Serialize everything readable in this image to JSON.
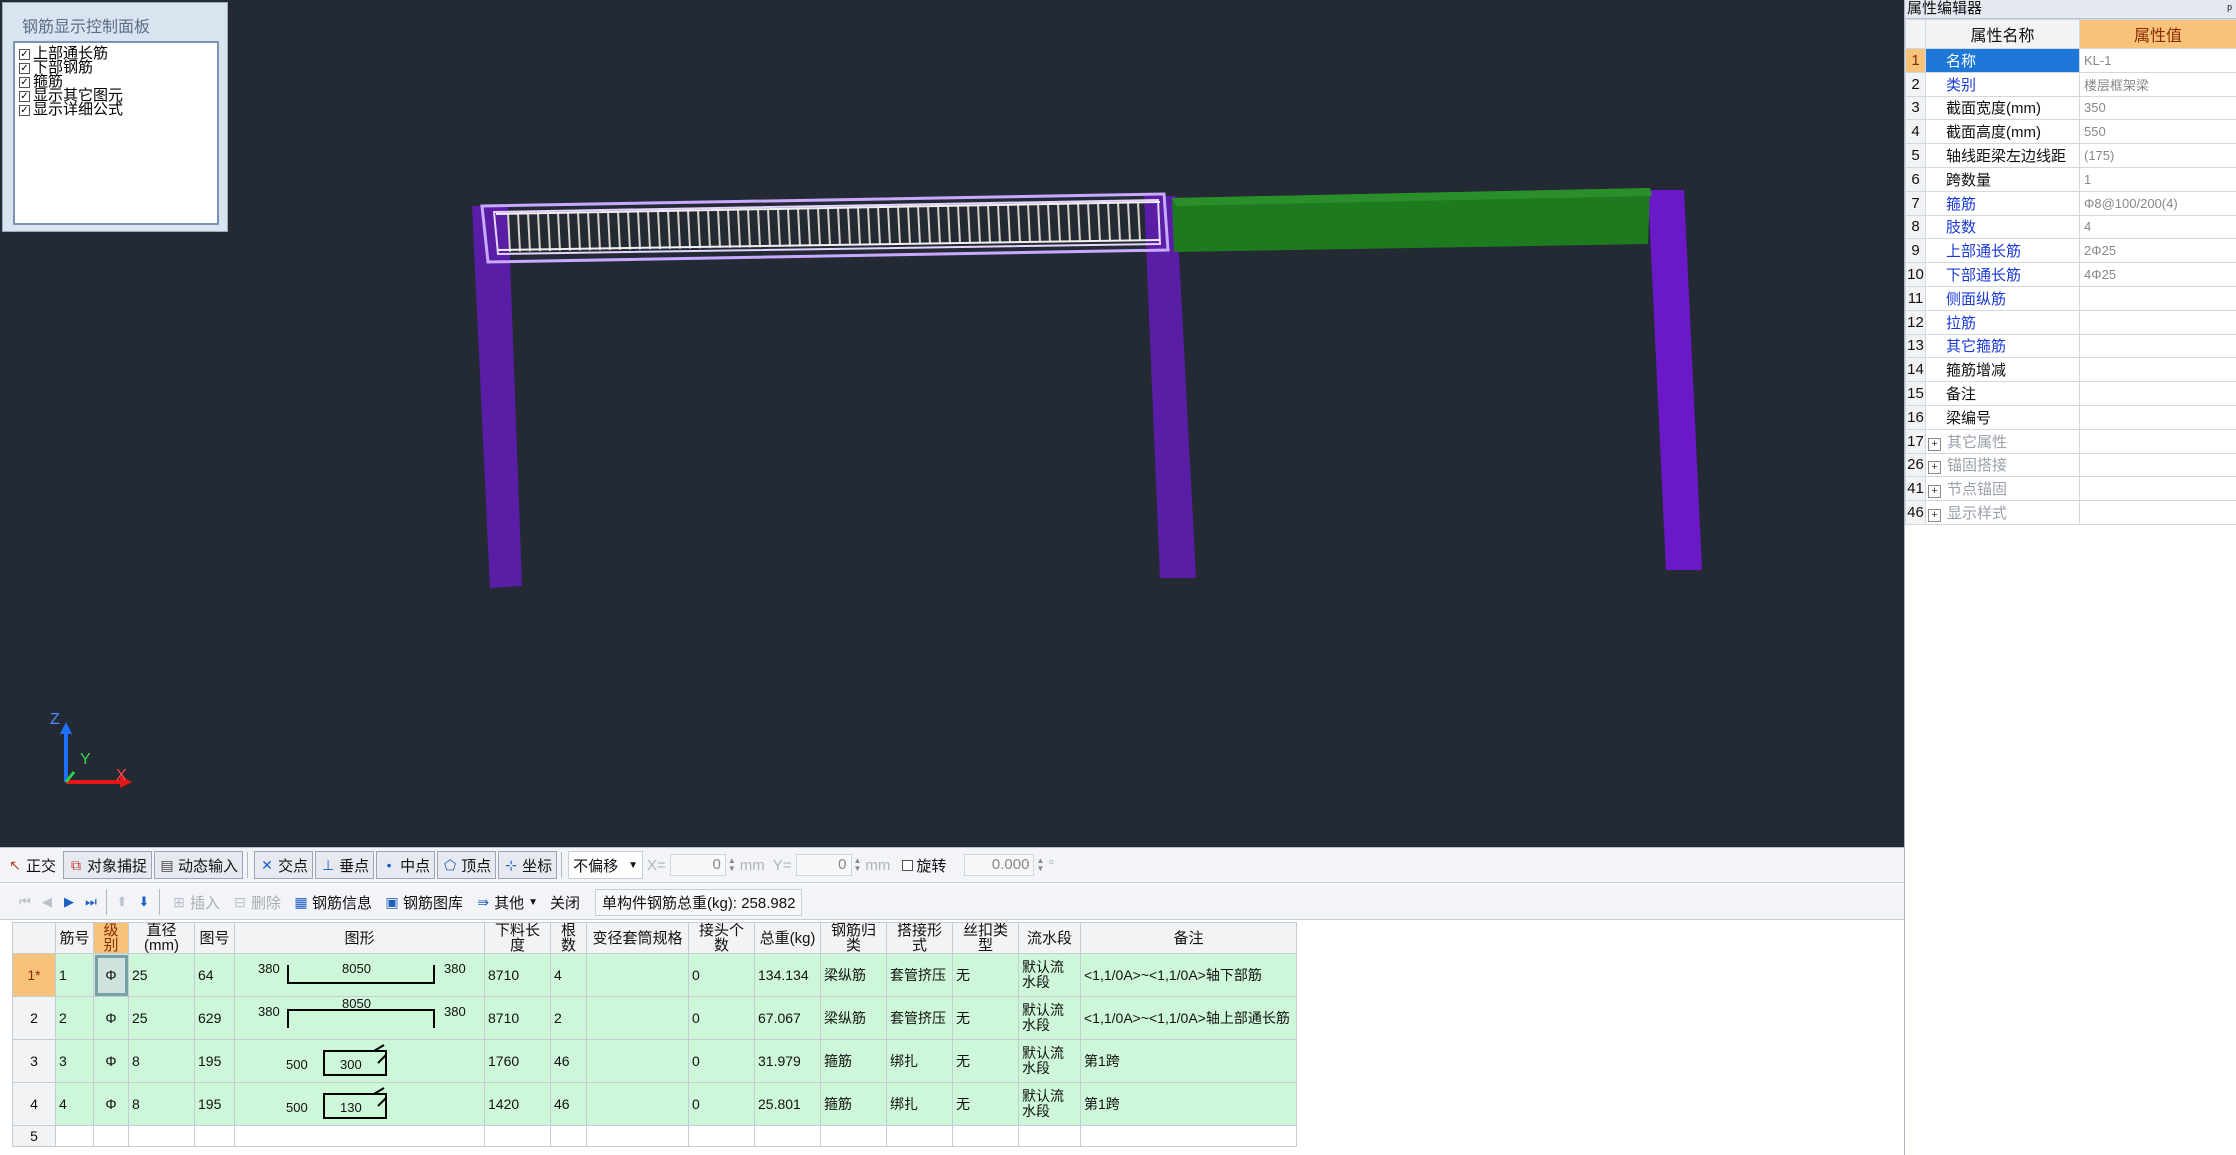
{
  "rebar_panel": {
    "title": "钢筋显示控制面板",
    "items": [
      {
        "label": "上部通长筋",
        "checked": true
      },
      {
        "label": "下部钢筋",
        "checked": true
      },
      {
        "label": "箍筋",
        "checked": true
      },
      {
        "label": "显示其它图元",
        "checked": true
      },
      {
        "label": "显示详细公式",
        "checked": true
      }
    ]
  },
  "axes": {
    "z": "Z",
    "y": "Y",
    "x": "X"
  },
  "colors": {
    "viewport_bg": "#232a34",
    "column": "#5a1ea6",
    "beam_green": "#1e7a1e",
    "selected_row": "#cdf7d8",
    "header_accent": "#f7c27a"
  },
  "property_editor": {
    "title": "属性编辑器",
    "pin": "ᵖ",
    "col_name": "属性名称",
    "col_value": "属性值",
    "rows": [
      {
        "n": "1",
        "name": "名称",
        "value": "KL-1",
        "style": "blue",
        "selected": true
      },
      {
        "n": "2",
        "name": "类别",
        "value": "楼层框架梁",
        "style": "blue"
      },
      {
        "n": "3",
        "name": "截面宽度(mm)",
        "value": "350",
        "style": "black"
      },
      {
        "n": "4",
        "name": "截面高度(mm)",
        "value": "550",
        "style": "black"
      },
      {
        "n": "5",
        "name": "轴线距梁左边线距",
        "value": "(175)",
        "style": "black"
      },
      {
        "n": "6",
        "name": "跨数量",
        "value": "1",
        "style": "black"
      },
      {
        "n": "7",
        "name": "箍筋",
        "value": "Φ8@100/200(4)",
        "style": "blue"
      },
      {
        "n": "8",
        "name": "肢数",
        "value": "4",
        "style": "blue"
      },
      {
        "n": "9",
        "name": "上部通长筋",
        "value": "2Φ25",
        "style": "blue"
      },
      {
        "n": "10",
        "name": "下部通长筋",
        "value": "4Φ25",
        "style": "blue"
      },
      {
        "n": "11",
        "name": "侧面纵筋",
        "value": "",
        "style": "blue"
      },
      {
        "n": "12",
        "name": "拉筋",
        "value": "",
        "style": "blue"
      },
      {
        "n": "13",
        "name": "其它箍筋",
        "value": "",
        "style": "blue"
      },
      {
        "n": "14",
        "name": "箍筋增减",
        "value": "",
        "style": "black"
      },
      {
        "n": "15",
        "name": "备注",
        "value": "",
        "style": "black"
      },
      {
        "n": "16",
        "name": "梁编号",
        "value": "",
        "style": "black"
      },
      {
        "n": "17",
        "name": "其它属性",
        "value": "",
        "style": "gray",
        "expand": "+"
      },
      {
        "n": "26",
        "name": "锚固搭接",
        "value": "",
        "style": "gray",
        "expand": "+"
      },
      {
        "n": "41",
        "name": "节点锚固",
        "value": "",
        "style": "gray",
        "expand": "+"
      },
      {
        "n": "46",
        "name": "显示样式",
        "value": "",
        "style": "gray",
        "expand": "+"
      }
    ]
  },
  "snap_toolbar": {
    "ortho": "正交",
    "object_snap": "对象捕捉",
    "dynamic_input": "动态输入",
    "intersection": "交点",
    "perpendicular": "垂点",
    "midpoint": "中点",
    "vertex": "顶点",
    "coordinate": "坐标",
    "offset_mode": "不偏移",
    "x_label": "X=",
    "x_value": "0",
    "y_label": "Y=",
    "y_value": "0",
    "unit": "mm",
    "rotate": "旋转",
    "rotate_value": "0.000",
    "degree": "°"
  },
  "rebar_toolbar": {
    "insert": "插入",
    "delete": "删除",
    "rebar_info": "钢筋信息",
    "rebar_library": "钢筋图库",
    "other": "其他",
    "close": "关闭",
    "total_weight_label": "单构件钢筋总重(kg):",
    "total_weight_value": "258.982"
  },
  "grid": {
    "headers": [
      "",
      "筋号",
      "级别",
      "直径(mm)",
      "图号",
      "图形",
      "下料长度",
      "根数",
      "变径套筒规格",
      "接头个数",
      "总重(kg)",
      "钢筋归类",
      "搭接形式",
      "丝扣类型",
      "流水段",
      "备注"
    ],
    "rows": [
      {
        "row_no": "1*",
        "no": "1",
        "level": "Φ",
        "dia": "25",
        "fig": "64",
        "shape_left": "380",
        "shape_mid": "8050",
        "shape_right": "380",
        "length": "8710",
        "count": "4",
        "sleeve": "",
        "joints": "0",
        "weight": "134.134",
        "category": "梁纵筋",
        "splice": "套管挤压",
        "thread": "无",
        "flow": "默认流水段",
        "note": "<1,1/0A>~<1,1/0A>轴下部筋"
      },
      {
        "row_no": "2",
        "no": "2",
        "level": "Φ",
        "dia": "25",
        "fig": "629",
        "shape_left": "380",
        "shape_mid": "8050",
        "shape_right": "380",
        "length": "8710",
        "count": "2",
        "sleeve": "",
        "joints": "0",
        "weight": "67.067",
        "category": "梁纵筋",
        "splice": "套管挤压",
        "thread": "无",
        "flow": "默认流水段",
        "note": "<1,1/0A>~<1,1/0A>轴上部通长筋"
      },
      {
        "row_no": "3",
        "no": "3",
        "level": "Φ",
        "dia": "8",
        "fig": "195",
        "shape_left": "500",
        "shape_mid": "300",
        "shape_right": "",
        "length": "1760",
        "count": "46",
        "sleeve": "",
        "joints": "0",
        "weight": "31.979",
        "category": "箍筋",
        "splice": "绑扎",
        "thread": "无",
        "flow": "默认流水段",
        "note": "第1跨"
      },
      {
        "row_no": "4",
        "no": "4",
        "level": "Φ",
        "dia": "8",
        "fig": "195",
        "shape_left": "500",
        "shape_mid": "130",
        "shape_right": "",
        "length": "1420",
        "count": "46",
        "sleeve": "",
        "joints": "0",
        "weight": "25.801",
        "category": "箍筋",
        "splice": "绑扎",
        "thread": "无",
        "flow": "默认流水段",
        "note": "第1跨"
      }
    ],
    "empty_row_no": "5"
  }
}
